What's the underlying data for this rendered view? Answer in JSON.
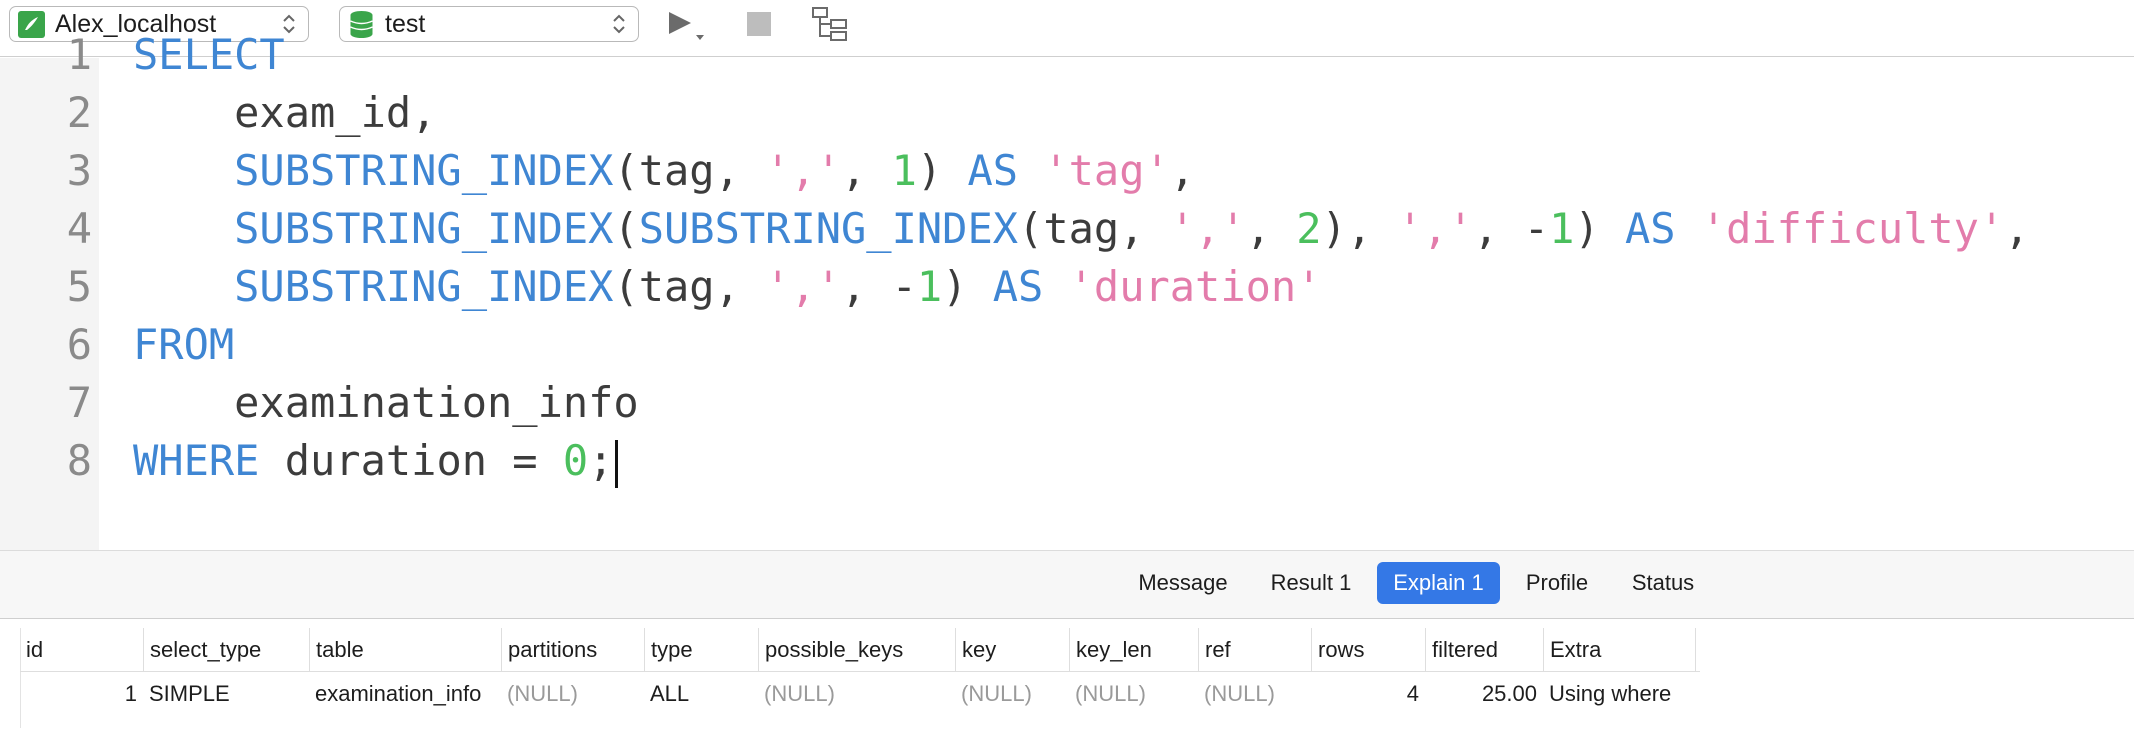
{
  "toolbar": {
    "connection": {
      "label": "Alex_localhost"
    },
    "database": {
      "label": "test"
    },
    "icons": {
      "run": "play-icon",
      "run_menu": "chevron-down-icon",
      "stop": "stop-icon",
      "explain": "explain-tree-icon"
    },
    "colors": {
      "connection_icon": "#3aa54a",
      "db_icon": "#3aa54a"
    }
  },
  "editor": {
    "line_numbers": [
      "1",
      "2",
      "3",
      "4",
      "5",
      "6",
      "7",
      "8"
    ],
    "lines": [
      [
        {
          "t": "kw",
          "v": "SELECT"
        }
      ],
      [
        {
          "t": "txt",
          "v": "    exam_id,"
        }
      ],
      [
        {
          "t": "kw",
          "v": "    SUBSTRING_INDEX"
        },
        {
          "t": "txt",
          "v": "(tag, "
        },
        {
          "t": "str",
          "v": "','"
        },
        {
          "t": "txt",
          "v": ", "
        },
        {
          "t": "num",
          "v": "1"
        },
        {
          "t": "txt",
          "v": ") "
        },
        {
          "t": "kw",
          "v": "AS"
        },
        {
          "t": "txt",
          "v": " "
        },
        {
          "t": "str",
          "v": "'tag'"
        },
        {
          "t": "txt",
          "v": ","
        }
      ],
      [
        {
          "t": "kw",
          "v": "    SUBSTRING_INDEX"
        },
        {
          "t": "txt",
          "v": "("
        },
        {
          "t": "kw",
          "v": "SUBSTRING_INDEX"
        },
        {
          "t": "txt",
          "v": "(tag, "
        },
        {
          "t": "str",
          "v": "','"
        },
        {
          "t": "txt",
          "v": ", "
        },
        {
          "t": "num",
          "v": "2"
        },
        {
          "t": "txt",
          "v": "), "
        },
        {
          "t": "str",
          "v": "','"
        },
        {
          "t": "txt",
          "v": ", -"
        },
        {
          "t": "num",
          "v": "1"
        },
        {
          "t": "txt",
          "v": ") "
        },
        {
          "t": "kw",
          "v": "AS"
        },
        {
          "t": "txt",
          "v": " "
        },
        {
          "t": "str",
          "v": "'difficulty'"
        },
        {
          "t": "txt",
          "v": ","
        }
      ],
      [
        {
          "t": "kw",
          "v": "    SUBSTRING_INDEX"
        },
        {
          "t": "txt",
          "v": "(tag, "
        },
        {
          "t": "str",
          "v": "','"
        },
        {
          "t": "txt",
          "v": ", -"
        },
        {
          "t": "num",
          "v": "1"
        },
        {
          "t": "txt",
          "v": ") "
        },
        {
          "t": "kw",
          "v": "AS"
        },
        {
          "t": "txt",
          "v": " "
        },
        {
          "t": "str",
          "v": "'duration'"
        }
      ],
      [
        {
          "t": "kw",
          "v": "FROM"
        }
      ],
      [
        {
          "t": "txt",
          "v": "    examination_info"
        }
      ],
      [
        {
          "t": "kw",
          "v": "WHERE"
        },
        {
          "t": "txt",
          "v": " duration = "
        },
        {
          "t": "num",
          "v": "0"
        },
        {
          "t": "txt",
          "v": ";"
        }
      ]
    ],
    "colors": {
      "keyword": "#3f86d3",
      "string": "#e37cab",
      "number": "#4bbf5d",
      "text": "#3c3c3c"
    }
  },
  "tabs": [
    {
      "label": "Message",
      "active": false
    },
    {
      "label": "Result 1",
      "active": false
    },
    {
      "label": "Explain 1",
      "active": true
    },
    {
      "label": "Profile",
      "active": false
    },
    {
      "label": "Status",
      "active": false
    }
  ],
  "grid": {
    "columns": [
      "id",
      "select_type",
      "table",
      "partitions",
      "type",
      "possible_keys",
      "key",
      "key_len",
      "ref",
      "rows",
      "filtered",
      "Extra"
    ],
    "rows": [
      [
        "1",
        "SIMPLE",
        "examination_info",
        "(NULL)",
        "ALL",
        "(NULL)",
        "(NULL)",
        "(NULL)",
        "(NULL)",
        "4",
        "25.00",
        "Using where"
      ]
    ]
  }
}
